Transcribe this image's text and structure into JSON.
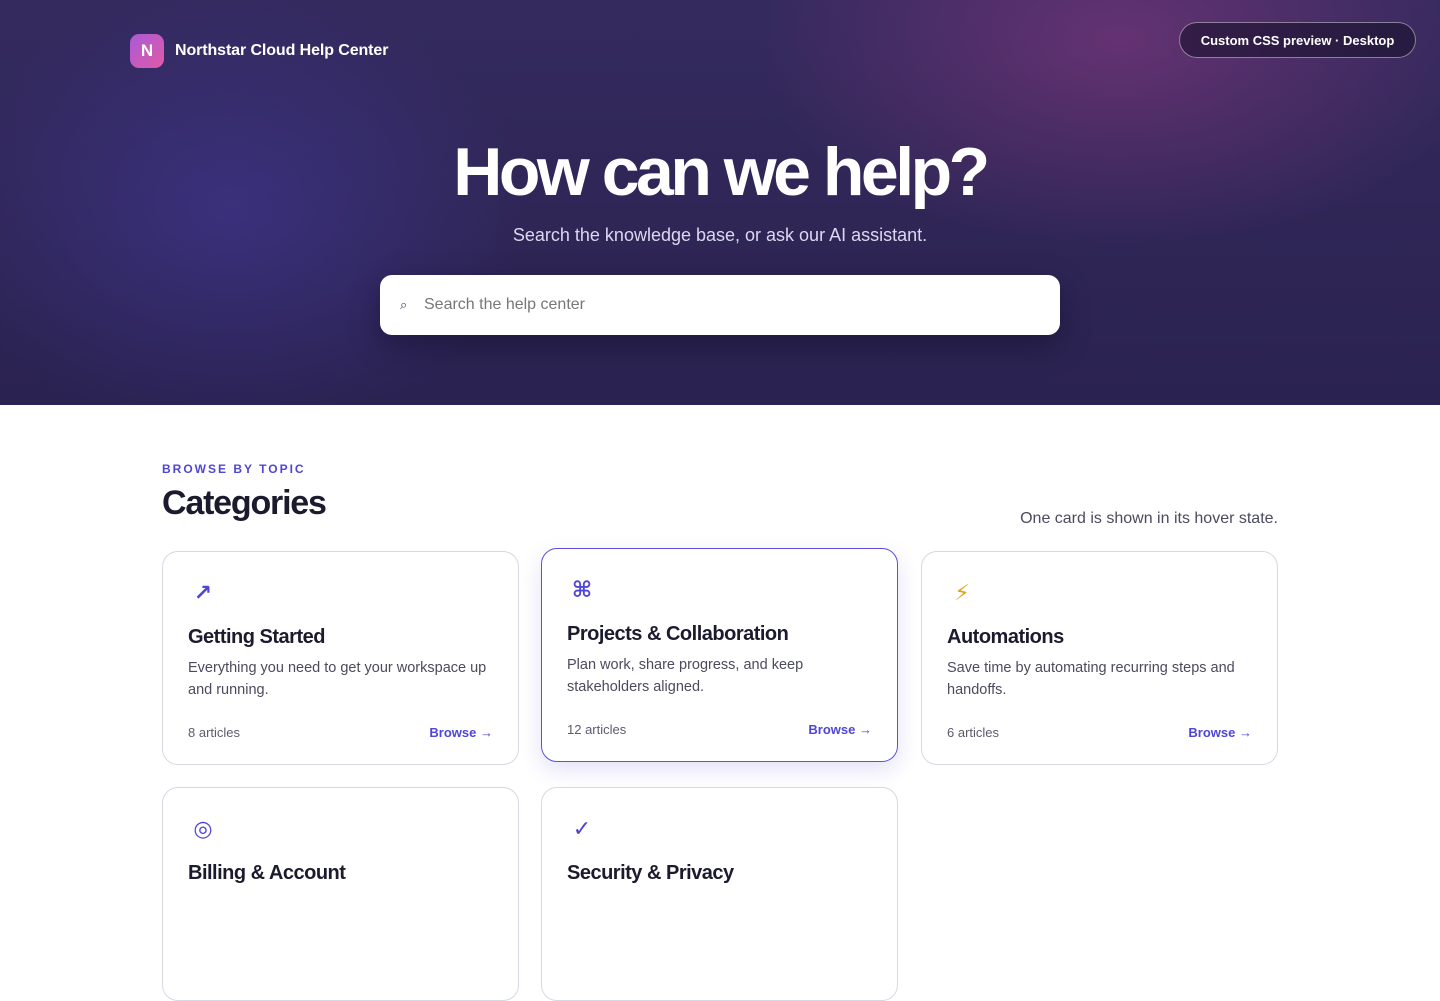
{
  "header": {
    "logo_letter": "N",
    "brand_name": "Northstar Cloud Help Center",
    "preview_badge": "Custom CSS preview · Desktop"
  },
  "hero": {
    "title": "How can we help?",
    "subtitle": "Search the knowledge base, or ask our AI assistant.",
    "search_icon": "⌕",
    "search_placeholder": "Search the help center"
  },
  "categories": {
    "eyebrow": "BROWSE BY TOPIC",
    "title": "Categories",
    "note": "One card is shown in its hover state.",
    "cards": [
      {
        "icon": "arrow-up-right-icon",
        "glyph": "↗",
        "title": "Getting Started",
        "description": "Everything you need to get your workspace up and running.",
        "count": "8 articles",
        "browse": "Browse →"
      },
      {
        "icon": "command-icon",
        "glyph": "⌘",
        "title": "Projects & Collaboration",
        "description": "Plan work, share progress, and keep stakeholders aligned.",
        "count": "12 articles",
        "browse": "Browse →",
        "hover": true
      },
      {
        "icon": "lightning-bolt-icon",
        "glyph": "⚡",
        "title": "Automations",
        "description": "Save time by automating recurring steps and handoffs.",
        "count": "6 articles",
        "browse": "Browse →"
      },
      {
        "icon": "target-icon",
        "glyph": "◎",
        "title": "Billing & Account"
      },
      {
        "icon": "checkmark-icon",
        "glyph": "✓",
        "title": "Security & Privacy"
      }
    ]
  },
  "colors": {
    "accent": "#5046d6",
    "hero_dark": "#2f2656",
    "hero_glow": "#a03c8c",
    "bolt": "#e2a325"
  }
}
